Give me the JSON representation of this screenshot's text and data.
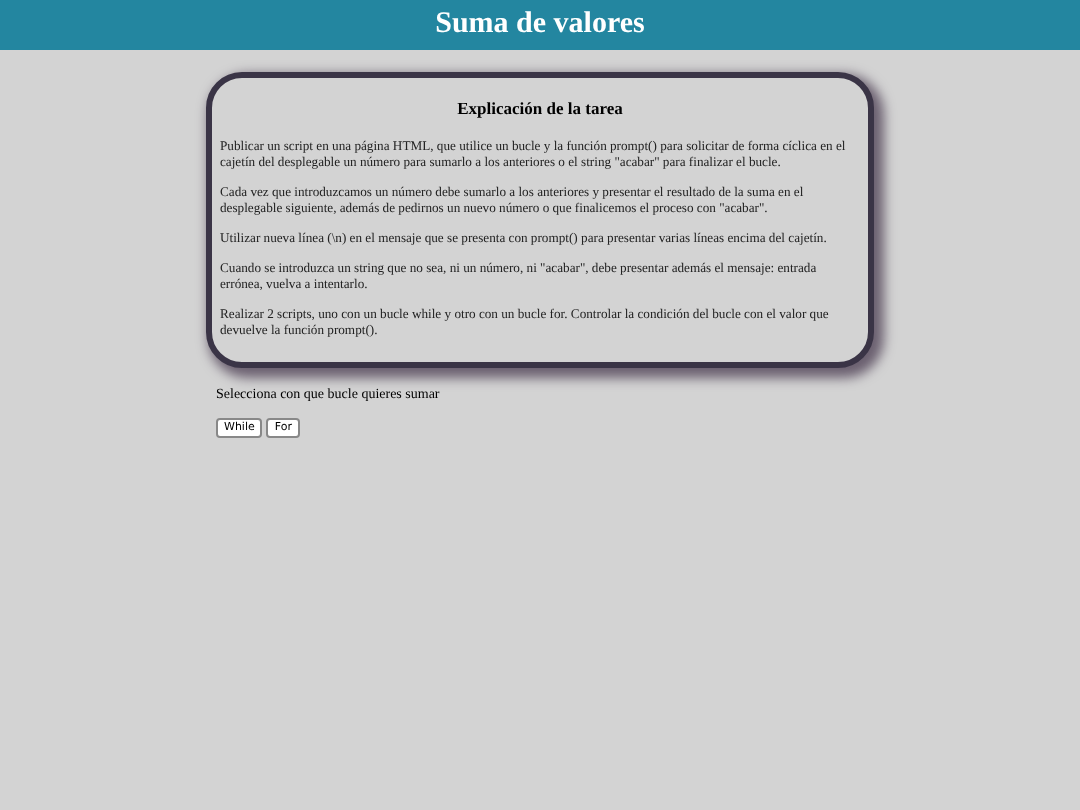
{
  "header": {
    "title": "Suma de valores"
  },
  "task": {
    "title": "Explicación de la tarea",
    "paragraphs": [
      "Publicar un script en una página HTML, que utilice un bucle y la función prompt() para solicitar de forma cíclica en el cajetín del desplegable un número para sumarlo a los anteriores o el string \"acabar\" para finalizar el bucle.",
      "Cada vez que introduzcamos un número debe sumarlo a los anteriores y presentar el resultado de la suma en el desplegable siguiente, además de pedirnos un nuevo número o que finalicemos el proceso con \"acabar\".",
      "Utilizar nueva línea (\\n) en el mensaje que se presenta con prompt() para presentar varias líneas encima del cajetín.",
      "Cuando se introduzca un string que no sea, ni un número, ni \"acabar\", debe presentar además el mensaje: entrada errónea, vuelva a intentarlo.",
      "Realizar 2 scripts, uno con un bucle while y otro con un bucle for. Controlar la condición del bucle con el valor que devuelve la función prompt()."
    ]
  },
  "prompt": "Selecciona con que bucle quieres sumar",
  "buttons": [
    "While",
    "For"
  ]
}
